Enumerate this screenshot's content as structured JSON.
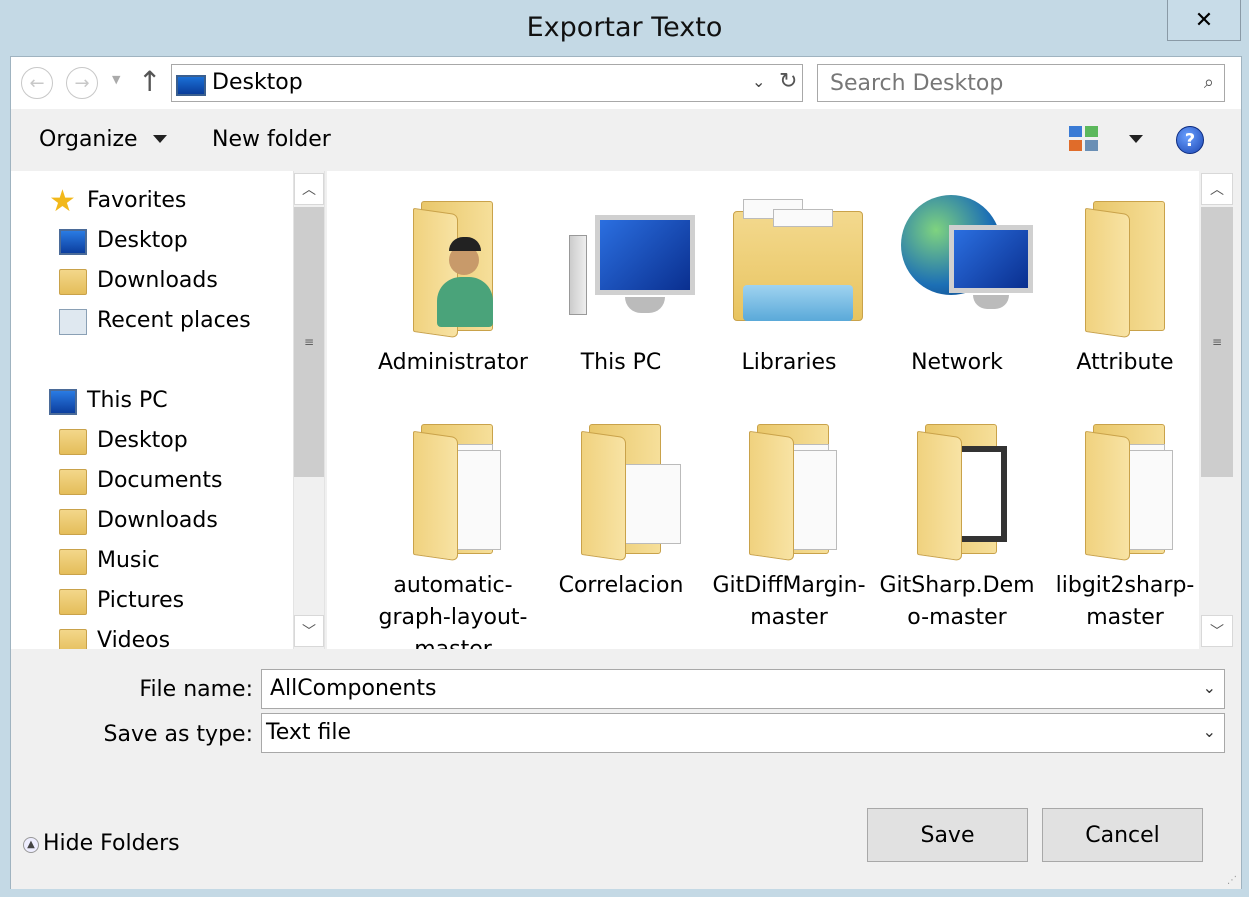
{
  "window": {
    "title": "Exportar Texto",
    "close_label": "✕"
  },
  "address": {
    "path": "Desktop",
    "search_placeholder": "Search Desktop"
  },
  "toolbar": {
    "organize_label": "Organize",
    "new_folder_label": "New folder",
    "help_label": "?"
  },
  "nav": {
    "items": [
      {
        "label": "Favorites",
        "icon": "star-icon"
      },
      {
        "label": "Desktop",
        "icon": "desktop-icon"
      },
      {
        "label": "Downloads",
        "icon": "downloads-folder-icon"
      },
      {
        "label": "Recent places",
        "icon": "recent-places-icon"
      },
      {
        "label": "This PC",
        "icon": "computer-icon"
      },
      {
        "label": "Desktop",
        "icon": "desktop-folder-icon"
      },
      {
        "label": "Documents",
        "icon": "documents-folder-icon"
      },
      {
        "label": "Downloads",
        "icon": "downloads-folder-icon"
      },
      {
        "label": "Music",
        "icon": "music-folder-icon"
      },
      {
        "label": "Pictures",
        "icon": "pictures-folder-icon"
      },
      {
        "label": "Videos",
        "icon": "videos-folder-icon"
      }
    ]
  },
  "files": {
    "items": [
      {
        "label": "Administrator",
        "icon": "user-folder-icon"
      },
      {
        "label": "This PC",
        "icon": "computer-icon"
      },
      {
        "label": "Libraries",
        "icon": "libraries-icon"
      },
      {
        "label": "Network",
        "icon": "network-icon"
      },
      {
        "label": "Attribute",
        "icon": "folder-icon"
      },
      {
        "label": "automatic-graph-layout-master",
        "icon": "folder-icon"
      },
      {
        "label": "Correlacion",
        "icon": "folder-icon"
      },
      {
        "label": "GitDiffMargin-master",
        "icon": "folder-icon"
      },
      {
        "label": "GitSharp.Demo-master",
        "icon": "folder-icon"
      },
      {
        "label": "libgit2sharp-master",
        "icon": "folder-icon"
      }
    ]
  },
  "form": {
    "file_name_label": "File name:",
    "file_name_value": "AllComponents",
    "save_type_label": "Save as type:",
    "save_type_value": "Text file"
  },
  "buttons": {
    "save": "Save",
    "cancel": "Cancel",
    "hide_folders": "Hide Folders"
  },
  "colors": {
    "title_bg": "#c4d9e5",
    "pane_bg": "#f0f0f0",
    "folder": "#f0d27f"
  }
}
